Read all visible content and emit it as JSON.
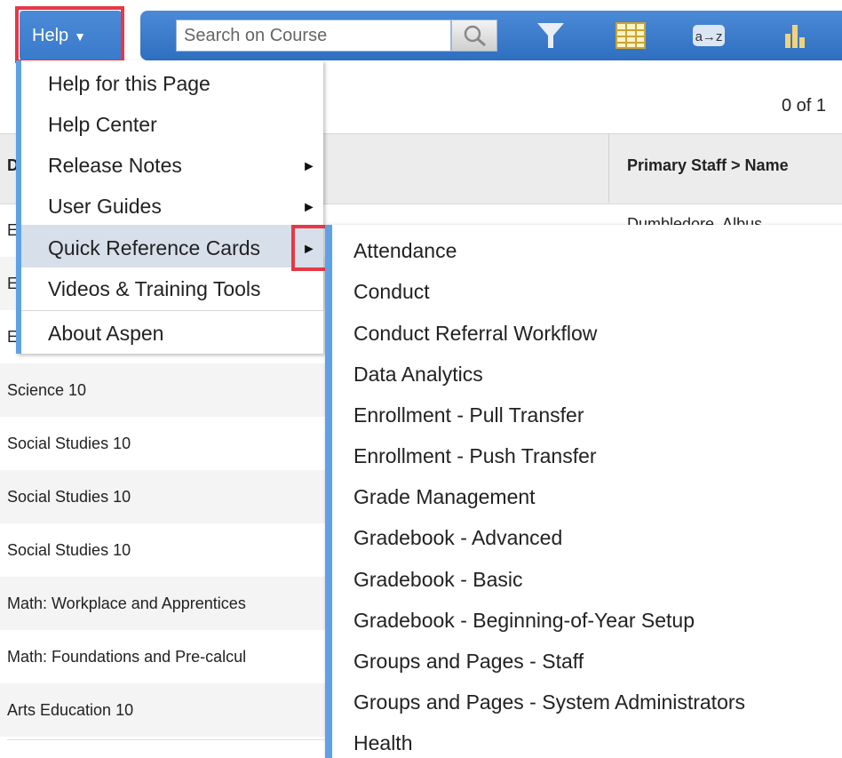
{
  "toolbar": {
    "help_label": "Help",
    "search_placeholder": "Search on Course",
    "icons": [
      "search-icon",
      "filter-icon",
      "grid-icon",
      "sort-az-icon",
      "chart-icon"
    ]
  },
  "table": {
    "record_count": "0 of 1",
    "headers": [
      "D",
      "Primary Staff > Name"
    ],
    "partial_staff": "Dumbledore, Albus",
    "rows": [
      "E",
      "E",
      "E",
      "Science 10",
      "Social Studies 10",
      "Social Studies 10",
      "Social Studies 10",
      "Math: Workplace and Apprentices",
      "Math: Foundations and Pre-calcul",
      "Arts Education 10"
    ]
  },
  "help_menu": {
    "items": [
      "Help for this Page",
      "Help Center",
      "Release Notes",
      "User Guides",
      "Quick Reference Cards",
      "Videos & Training Tools",
      "About Aspen"
    ],
    "arrow": "►"
  },
  "submenu": {
    "items": [
      "Attendance",
      "Conduct",
      "Conduct Referral Workflow",
      "Data Analytics",
      "Enrollment - Pull Transfer",
      "Enrollment - Push Transfer",
      "Grade Management",
      "Gradebook - Advanced",
      "Gradebook - Basic",
      "Gradebook - Beginning-of-Year Setup",
      "Groups and Pages - Staff",
      "Groups and Pages - System Administrators",
      "Health"
    ]
  },
  "colors": {
    "toolbar_blue": "#3a7acb",
    "menu_border_blue": "#5fa1e7",
    "highlight_red": "#e53945",
    "selected_item_bg": "#d6dfea"
  }
}
